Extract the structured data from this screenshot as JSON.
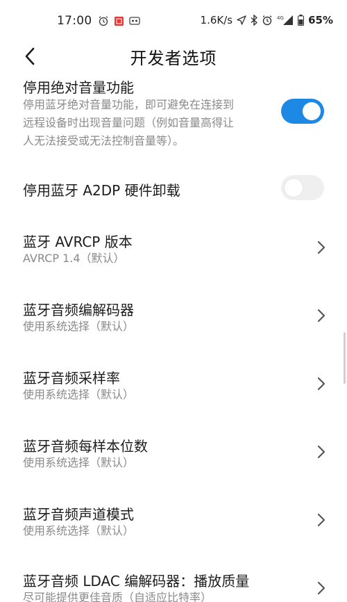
{
  "status_bar": {
    "time": "17:00",
    "network_speed": "1.6K/s",
    "signal_label": "4G",
    "battery": "65%"
  },
  "header": {
    "title": "开发者选项"
  },
  "settings": [
    {
      "title": "停用绝对音量功能",
      "desc_lines": [
        "停用蓝牙绝对音量功能，即可避免在连接到",
        "远程设备时出现音量问题（例如音量高得让",
        "人无法接受或无法控制音量等）。"
      ],
      "control": "toggle",
      "toggle_on": true
    },
    {
      "title": "停用蓝牙 A2DP 硬件卸载",
      "control": "toggle",
      "toggle_on": false
    },
    {
      "title": "蓝牙 AVRCP 版本",
      "subtitle": "AVRCP 1.4（默认）",
      "control": "chevron"
    },
    {
      "title": "蓝牙音频编解码器",
      "subtitle": "使用系统选择（默认）",
      "control": "chevron"
    },
    {
      "title": "蓝牙音频采样率",
      "subtitle": "使用系统选择（默认）",
      "control": "chevron"
    },
    {
      "title": "蓝牙音频每样本位数",
      "subtitle": "使用系统选择（默认）",
      "control": "chevron"
    },
    {
      "title": "蓝牙音频声道模式",
      "subtitle": "使用系统选择（默认）",
      "control": "chevron"
    },
    {
      "title": "蓝牙音频 LDAC 编解码器：播放质量",
      "subtitle": "尽可能提供更佳音质（自适应比特率）",
      "control": "chevron"
    }
  ],
  "colors": {
    "accent": "#1e88e5",
    "text_primary": "#1c1c1c",
    "text_secondary": "#8a8a8a"
  }
}
